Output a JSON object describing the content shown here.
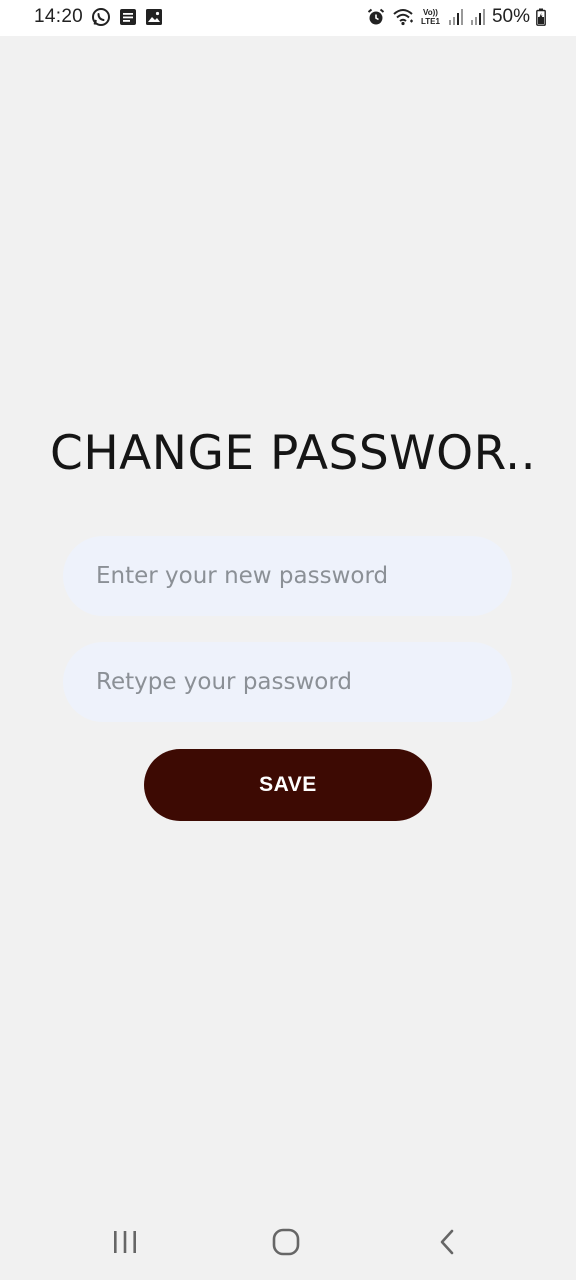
{
  "status_bar": {
    "time": "14:20",
    "battery_text": "50%",
    "left_icons": [
      "whatsapp-icon",
      "message-icon",
      "gallery-icon"
    ],
    "right_icons": [
      "alarm-icon",
      "wifi-icon",
      "volte-lte-icon",
      "signal-icon",
      "signal-icon",
      "battery-icon"
    ]
  },
  "screen": {
    "title": "CHANGE PASSWOR.."
  },
  "form": {
    "new_password_placeholder": "Enter your new password",
    "retype_password_placeholder": "Retype your password",
    "save_label": "SAVE"
  },
  "nav_bar": {
    "icons": [
      "recents-icon",
      "home-icon",
      "back-icon"
    ]
  },
  "colors": {
    "background": "#f1f1f1",
    "input_background": "#eef2fb",
    "save_button": "#3d0a03",
    "placeholder": "#8b9096"
  }
}
